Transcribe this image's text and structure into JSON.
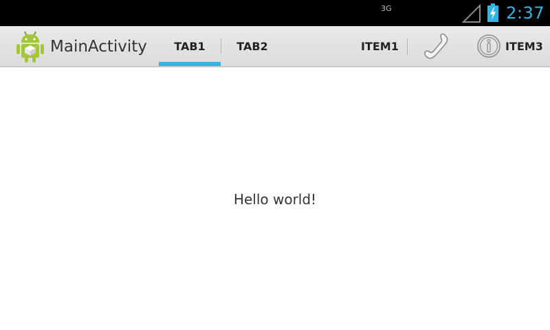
{
  "status_bar": {
    "network_type": "3G",
    "time": "2:37",
    "icons": [
      "signal-icon",
      "battery-charging-icon"
    ]
  },
  "action_bar": {
    "app_icon": "android-robot-icon",
    "title": "MainActivity",
    "tabs": [
      {
        "label": "TAB1",
        "selected": true
      },
      {
        "label": "TAB2",
        "selected": false
      }
    ],
    "menu": {
      "item1": "ITEM1",
      "phone_icon": "phone-icon",
      "item3": "ITEM3",
      "info_icon": "info-icon"
    }
  },
  "content": {
    "message": "Hello world!"
  },
  "colors": {
    "accent": "#33b5e5",
    "status_bar_bg": "#000000",
    "action_bar_bg": "#e3e3e3",
    "android_green": "#a4c639"
  }
}
